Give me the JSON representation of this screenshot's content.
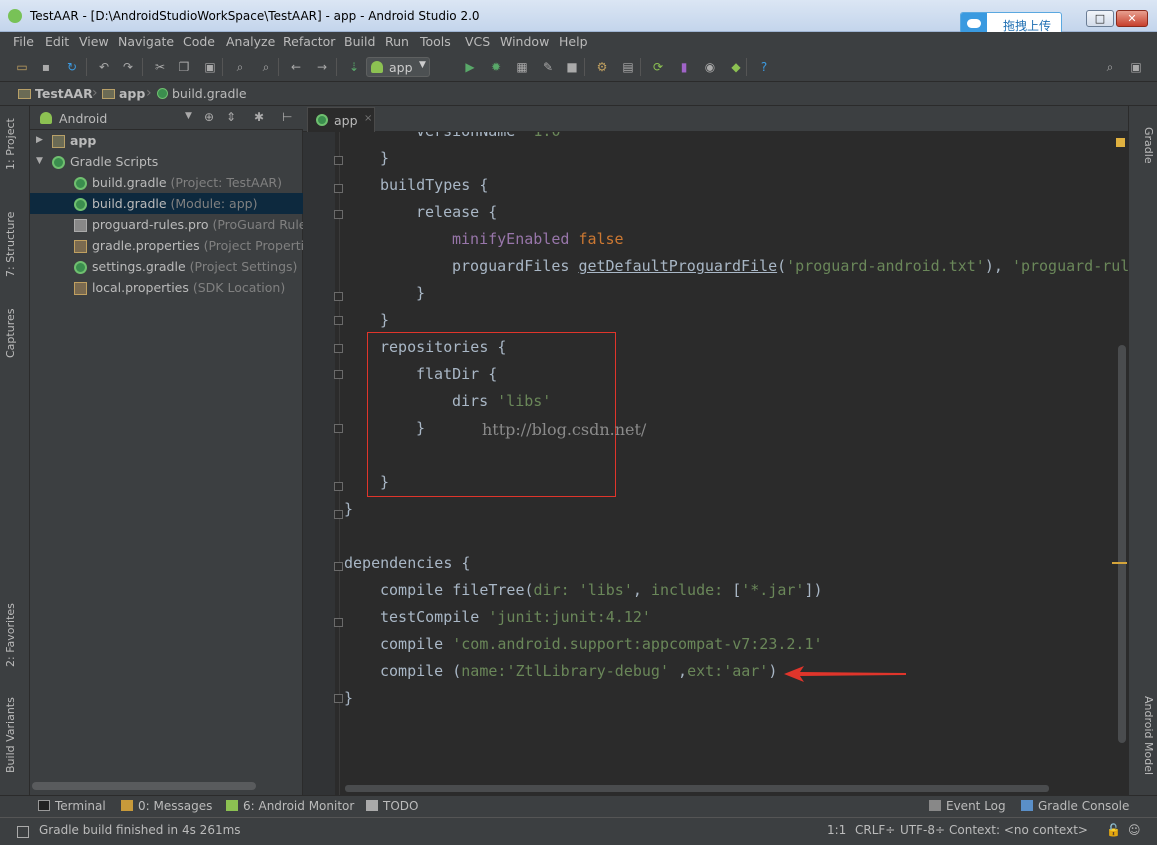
{
  "window": {
    "title": "TestAAR - [D:\\AndroidStudioWorkSpace\\TestAAR] - app - Android Studio 2.0",
    "upload_button": "拖拽上传",
    "min_glyph": "▁",
    "max_glyph": "□",
    "close_glyph": "✕"
  },
  "menu": [
    "File",
    "Edit",
    "View",
    "Navigate",
    "Code",
    "Analyze",
    "Refactor",
    "Build",
    "Run",
    "Tools",
    "VCS",
    "Window",
    "Help"
  ],
  "toolbar": {
    "run_config": "app",
    "icons": [
      "open-icon",
      "save-icon",
      "sync-icon",
      "undo-icon",
      "redo-icon",
      "cut-icon",
      "copy-icon",
      "paste-icon",
      "find-icon",
      "replace-icon",
      "back-icon",
      "forward-icon",
      "make-icon",
      "run-icon",
      "debug-icon",
      "attach-icon",
      "apply-changes-icon",
      "stop-icon",
      "sdk-icon",
      "project-structure-icon",
      "sync-gradle-icon",
      "avd-icon",
      "android-device-monitor-icon",
      "android-icon",
      "help-icon",
      "search-everywhere-icon",
      "user-icon"
    ]
  },
  "breadcrumb": [
    "TestAAR",
    "app",
    "build.gradle"
  ],
  "left_tabs": [
    "1: Project",
    "7: Structure",
    "Captures",
    "2: Favorites",
    "Build Variants"
  ],
  "right_tabs": [
    "Gradle",
    "Android Model"
  ],
  "project_panel": {
    "view": "Android",
    "items": [
      {
        "label": "app",
        "hint": "",
        "level": 0,
        "arrow": "▶",
        "icon": "folder",
        "selected": false,
        "bold": true
      },
      {
        "label": "Gradle Scripts",
        "hint": "",
        "level": 0,
        "arrow": "▼",
        "icon": "gradle",
        "selected": false,
        "bold": false
      },
      {
        "label": "build.gradle",
        "hint": "(Project: TestAAR)",
        "level": 1,
        "arrow": "",
        "icon": "gradle",
        "selected": false,
        "bold": false
      },
      {
        "label": "build.gradle",
        "hint": "(Module: app)",
        "level": 1,
        "arrow": "",
        "icon": "gradle",
        "selected": true,
        "bold": false
      },
      {
        "label": "proguard-rules.pro",
        "hint": "(ProGuard Rules",
        "level": 1,
        "arrow": "",
        "icon": "file",
        "selected": false,
        "bold": false
      },
      {
        "label": "gradle.properties",
        "hint": "(Project Properties",
        "level": 1,
        "arrow": "",
        "icon": "prop",
        "selected": false,
        "bold": false
      },
      {
        "label": "settings.gradle",
        "hint": "(Project Settings)",
        "level": 1,
        "arrow": "",
        "icon": "gradle",
        "selected": false,
        "bold": false
      },
      {
        "label": "local.properties",
        "hint": "(SDK Location)",
        "level": 1,
        "arrow": "",
        "icon": "prop",
        "selected": false,
        "bold": false
      }
    ]
  },
  "editor": {
    "tab": "app",
    "close_glyph": "×",
    "watermark": "http://blog.csdn.net/",
    "lines": [
      {
        "indent": 3,
        "parts": [
          {
            "t": "versionName ",
            "c": "p"
          },
          {
            "t": "\"1.0\"",
            "c": "s"
          }
        ]
      },
      {
        "indent": 2,
        "parts": [
          {
            "t": "}",
            "c": "p"
          }
        ]
      },
      {
        "indent": 2,
        "parts": [
          {
            "t": "buildTypes {",
            "c": "p"
          }
        ]
      },
      {
        "indent": 3,
        "parts": [
          {
            "t": "release {",
            "c": "p"
          }
        ]
      },
      {
        "indent": 4,
        "parts": [
          {
            "t": "minifyEnabled ",
            "c": "n"
          },
          {
            "t": "false",
            "c": "k"
          }
        ]
      },
      {
        "indent": 4,
        "parts": [
          {
            "t": "proguardFiles ",
            "c": "p"
          },
          {
            "t": "getDefaultProguardFile",
            "c": "u"
          },
          {
            "t": "(",
            "c": "p"
          },
          {
            "t": "'proguard-android.txt'",
            "c": "s"
          },
          {
            "t": "), ",
            "c": "p"
          },
          {
            "t": "'proguard-rul",
            "c": "s"
          }
        ]
      },
      {
        "indent": 3,
        "parts": [
          {
            "t": "}",
            "c": "p"
          }
        ]
      },
      {
        "indent": 2,
        "parts": [
          {
            "t": "}",
            "c": "p"
          }
        ]
      },
      {
        "indent": 2,
        "parts": [
          {
            "t": "repositories {",
            "c": "p"
          }
        ]
      },
      {
        "indent": 3,
        "parts": [
          {
            "t": "flatDir {",
            "c": "p"
          }
        ]
      },
      {
        "indent": 4,
        "parts": [
          {
            "t": "dirs ",
            "c": "p"
          },
          {
            "t": "'libs'",
            "c": "s"
          }
        ]
      },
      {
        "indent": 3,
        "parts": [
          {
            "t": "}",
            "c": "p"
          }
        ]
      },
      {
        "indent": 0,
        "parts": []
      },
      {
        "indent": 2,
        "parts": [
          {
            "t": "}",
            "c": "p"
          }
        ]
      },
      {
        "indent": 0,
        "parts": [
          {
            "t": "}",
            "c": "p"
          }
        ]
      },
      {
        "indent": 0,
        "parts": []
      },
      {
        "indent": 0,
        "parts": [
          {
            "t": "dependencies {",
            "c": "p"
          }
        ]
      },
      {
        "indent": 2,
        "parts": [
          {
            "t": "compile fileTree(",
            "c": "p"
          },
          {
            "t": "dir: ",
            "c": "s"
          },
          {
            "t": "'libs'",
            "c": "s"
          },
          {
            "t": ", ",
            "c": "p"
          },
          {
            "t": "include: ",
            "c": "s"
          },
          {
            "t": "[",
            "c": "p"
          },
          {
            "t": "'*.jar'",
            "c": "s"
          },
          {
            "t": "])",
            "c": "p"
          }
        ]
      },
      {
        "indent": 2,
        "parts": [
          {
            "t": "testCompile ",
            "c": "p"
          },
          {
            "t": "'junit:junit:4.12'",
            "c": "s"
          }
        ]
      },
      {
        "indent": 2,
        "parts": [
          {
            "t": "compile ",
            "c": "p"
          },
          {
            "t": "'com.android.support:appcompat-v7:23.2.1'",
            "c": "s"
          }
        ]
      },
      {
        "indent": 2,
        "parts": [
          {
            "t": "compile ",
            "c": "p"
          },
          {
            "t": "(",
            "c": "p"
          },
          {
            "t": "name:",
            "c": "s"
          },
          {
            "t": "'ZtlLibrary-debug'",
            "c": "s"
          },
          {
            "t": " ,",
            "c": "p"
          },
          {
            "t": "ext:",
            "c": "s"
          },
          {
            "t": "'aar'",
            "c": "s"
          },
          {
            "t": ")",
            "c": "p"
          }
        ]
      },
      {
        "indent": 0,
        "parts": [
          {
            "t": "}",
            "c": "p"
          }
        ]
      }
    ]
  },
  "bottom_tools": [
    {
      "label": "Terminal",
      "icon": "terminal-icon",
      "color": "#222"
    },
    {
      "label": "0: Messages",
      "icon": "messages-icon",
      "color": "#c89a3a"
    },
    {
      "label": "6: Android Monitor",
      "icon": "android-monitor-icon",
      "color": "#8cc152"
    },
    {
      "label": "TODO",
      "icon": "todo-icon",
      "color": "#aaaaaa"
    },
    {
      "label": "Event Log",
      "icon": "event-log-icon",
      "color": "#888"
    },
    {
      "label": "Gradle Console",
      "icon": "gradle-console-icon",
      "color": "#5a8fc8"
    }
  ],
  "status": {
    "message": "Gradle build finished in 4s 261ms",
    "position": "1:1",
    "line_sep": "CRLF÷",
    "encoding": "UTF-8÷",
    "context": "Context: <no context>"
  },
  "colors": {
    "keyword": "#cc7832",
    "string": "#6a8759",
    "field": "#9876aa",
    "annotation": "#e0352b"
  }
}
